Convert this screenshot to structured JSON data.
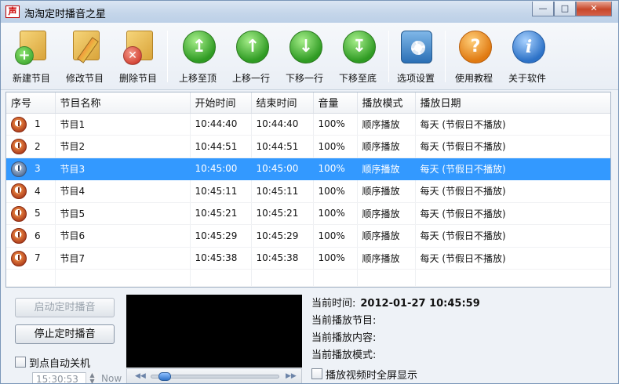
{
  "window": {
    "title": "淘淘定时播音之星",
    "app_icon_glyph": "声"
  },
  "toolbar": [
    {
      "id": "new",
      "label": "新建节目",
      "icon": "new-program-icon"
    },
    {
      "id": "edit",
      "label": "修改节目",
      "icon": "edit-program-icon"
    },
    {
      "id": "delete",
      "label": "删除节目",
      "icon": "delete-program-icon"
    },
    {
      "id": "top",
      "label": "上移至顶",
      "icon": "move-top-icon"
    },
    {
      "id": "up",
      "label": "上移一行",
      "icon": "move-up-icon"
    },
    {
      "id": "down",
      "label": "下移一行",
      "icon": "move-down-icon"
    },
    {
      "id": "bottom",
      "label": "下移至底",
      "icon": "move-bottom-icon"
    },
    {
      "id": "settings",
      "label": "选项设置",
      "icon": "settings-icon"
    },
    {
      "id": "tutorial",
      "label": "使用教程",
      "icon": "help-icon"
    },
    {
      "id": "about",
      "label": "关于软件",
      "icon": "info-icon"
    }
  ],
  "table": {
    "columns": [
      "序号",
      "节目名称",
      "开始时间",
      "结束时间",
      "音量",
      "播放模式",
      "播放日期"
    ],
    "rows": [
      {
        "seq": "1",
        "name": "节目1",
        "start": "10:44:40",
        "end": "10:44:40",
        "volume": "100%",
        "mode": "顺序播放",
        "date": "每天 (节假日不播放)"
      },
      {
        "seq": "2",
        "name": "节目2",
        "start": "10:44:51",
        "end": "10:44:51",
        "volume": "100%",
        "mode": "顺序播放",
        "date": "每天 (节假日不播放)"
      },
      {
        "seq": "3",
        "name": "节目3",
        "start": "10:45:00",
        "end": "10:45:00",
        "volume": "100%",
        "mode": "顺序播放",
        "date": "每天 (节假日不播放)"
      },
      {
        "seq": "4",
        "name": "节目4",
        "start": "10:45:11",
        "end": "10:45:11",
        "volume": "100%",
        "mode": "顺序播放",
        "date": "每天 (节假日不播放)"
      },
      {
        "seq": "5",
        "name": "节目5",
        "start": "10:45:21",
        "end": "10:45:21",
        "volume": "100%",
        "mode": "顺序播放",
        "date": "每天 (节假日不播放)"
      },
      {
        "seq": "6",
        "name": "节目6",
        "start": "10:45:29",
        "end": "10:45:29",
        "volume": "100%",
        "mode": "顺序播放",
        "date": "每天 (节假日不播放)"
      },
      {
        "seq": "7",
        "name": "节目7",
        "start": "10:45:38",
        "end": "10:45:38",
        "volume": "100%",
        "mode": "顺序播放",
        "date": "每天 (节假日不播放)"
      }
    ],
    "selected_index": 2
  },
  "controls": {
    "start_label": "启动定时播音",
    "stop_label": "停止定时播音",
    "auto_shutdown_label": "到点自动关机",
    "shutdown_time": "15:30:53",
    "now_label": "Now"
  },
  "info": {
    "current_time_label": "当前时间:",
    "current_time_value": "2012-01-27 10:45:59",
    "current_program_label": "当前播放节目:",
    "current_content_label": "当前播放内容:",
    "current_mode_label": "当前播放模式:",
    "fullscreen_label": "播放视频时全屏显示"
  },
  "player": {
    "seek_fraction": 0.06
  },
  "colors": {
    "selection": "#3399ff",
    "accent_green": "#2f9b23",
    "accent_red": "#c72417"
  }
}
